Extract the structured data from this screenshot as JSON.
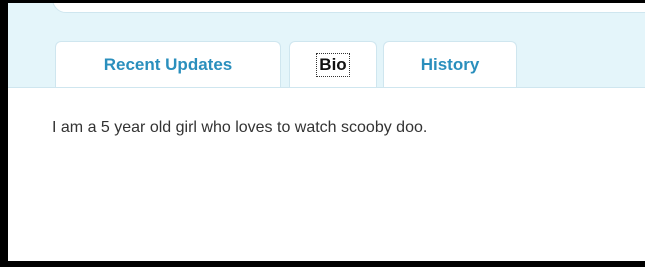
{
  "tabs": [
    {
      "label": "Recent Updates",
      "active": false
    },
    {
      "label": "Bio",
      "active": true
    },
    {
      "label": "History",
      "active": false
    }
  ],
  "bio": {
    "text": "I am a 5 year old girl who loves to watch scooby doo."
  },
  "colors": {
    "tab_strip_bg": "#e4f5fa",
    "tab_label": "#2a8fbd",
    "active_tab_label": "#111111",
    "body_text": "#333333"
  }
}
